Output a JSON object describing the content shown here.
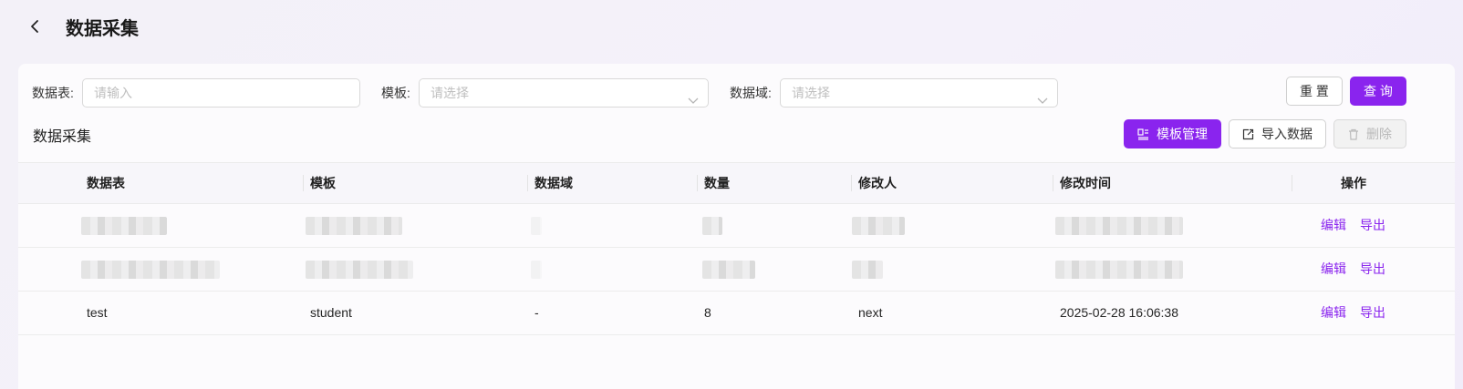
{
  "header": {
    "title": "数据采集"
  },
  "filters": {
    "table": {
      "label": "数据表:",
      "placeholder": "请输入"
    },
    "template": {
      "label": "模板:",
      "placeholder": "请选择"
    },
    "domain": {
      "label": "数据域:",
      "placeholder": "请选择"
    }
  },
  "actions": {
    "reset": "重 置",
    "query": "查 询"
  },
  "section": {
    "title": "数据采集",
    "template_manage": "模板管理",
    "import_data": "导入数据",
    "delete": "删除"
  },
  "table": {
    "columns": [
      "数据表",
      "模板",
      "数据域",
      "数量",
      "修改人",
      "修改时间",
      "操作"
    ],
    "rows": [
      {
        "blurred": true,
        "edit": "编辑",
        "export": "导出"
      },
      {
        "blurred": true,
        "edit": "编辑",
        "export": "导出"
      },
      {
        "blurred": false,
        "name": "test",
        "template": "student",
        "domain": "-",
        "count": "8",
        "modifier": "next",
        "modified_time": "2025-02-28 16:06:38",
        "edit": "编辑",
        "export": "导出"
      }
    ]
  },
  "colors": {
    "primary": "#8a24ee"
  },
  "icons": [
    "back-arrow-icon",
    "chevron-down-icon",
    "template-icon",
    "import-icon",
    "trash-icon"
  ]
}
